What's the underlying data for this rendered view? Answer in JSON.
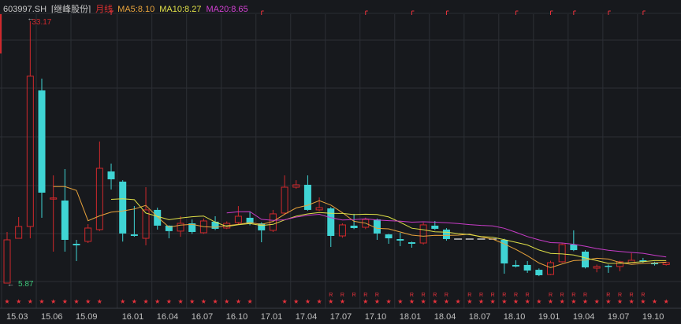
{
  "header": {
    "code": "603997.SH",
    "name": "[继峰股份]",
    "period": "月线",
    "ma5": "MA5:8.10",
    "ma10": "MA10:8.27",
    "ma20": "MA20:8.65"
  },
  "colors": {
    "background": "#17191d",
    "up": "#d0282c",
    "down": "#3fd4d4",
    "ma5": "#e8a33c",
    "ma10": "#e0e048",
    "ma20": "#c83cc8",
    "grid": "#2c2f35",
    "marker": "#e8323c"
  },
  "chart_data": {
    "type": "candlestick",
    "title": "603997.SH [继峰股份] 月线",
    "ylim": [
      5.87,
      33.17
    ],
    "max_label": "33.17",
    "min_label": "5.87",
    "max_index": 2,
    "min_index": 0,
    "xticks": [
      {
        "i": 0,
        "label": "15.03"
      },
      {
        "i": 3,
        "label": "15.06"
      },
      {
        "i": 6,
        "label": "15.09"
      },
      {
        "i": 10,
        "label": "16.01"
      },
      {
        "i": 13,
        "label": "16.04"
      },
      {
        "i": 16,
        "label": "16.07"
      },
      {
        "i": 19,
        "label": "16.10"
      },
      {
        "i": 22,
        "label": "17.01"
      },
      {
        "i": 25,
        "label": "17.04"
      },
      {
        "i": 28,
        "label": "17.07"
      },
      {
        "i": 31,
        "label": "17.10"
      },
      {
        "i": 34,
        "label": "18.01"
      },
      {
        "i": 37,
        "label": "18.04"
      },
      {
        "i": 40,
        "label": "18.07"
      },
      {
        "i": 43,
        "label": "18.10"
      },
      {
        "i": 46,
        "label": "19.01"
      },
      {
        "i": 49,
        "label": "19.04"
      },
      {
        "i": 52,
        "label": "19.07"
      },
      {
        "i": 55,
        "label": "19.10"
      }
    ],
    "ohlc": [
      [
        5.87,
        10.38,
        11.2,
        5.87
      ],
      [
        10.54,
        11.77,
        12.76,
        10.54
      ],
      [
        11.77,
        27.44,
        33.17,
        10.54
      ],
      [
        25.96,
        15.3,
        27.19,
        12.68
      ],
      [
        14.7,
        14.75,
        17.1,
        9.15
      ],
      [
        14.48,
        10.38,
        17.76,
        9.15
      ],
      [
        9.97,
        9.81,
        10.38,
        8.17
      ],
      [
        10.22,
        11.61,
        12.02,
        10.05
      ],
      [
        11.45,
        17.84,
        20.63,
        11.3
      ],
      [
        17.51,
        16.69,
        18.33,
        15.63
      ],
      [
        16.45,
        11.04,
        16.6,
        10.2
      ],
      [
        10.95,
        10.79,
        13.9,
        10.7
      ],
      [
        10.54,
        13.5,
        15.87,
        9.81
      ],
      [
        13.5,
        11.86,
        13.74,
        11.45
      ],
      [
        11.86,
        11.29,
        11.9,
        10.54
      ],
      [
        11.29,
        12.1,
        12.84,
        10.7
      ],
      [
        12.1,
        11.2,
        12.5,
        11.0
      ],
      [
        11.12,
        12.35,
        12.6,
        11.0
      ],
      [
        12.27,
        11.53,
        12.84,
        11.4
      ],
      [
        11.61,
        12.1,
        12.3,
        11.5
      ],
      [
        12.18,
        12.84,
        13.9,
        12.0
      ],
      [
        12.68,
        12.1,
        13.3,
        11.9
      ],
      [
        12.1,
        11.37,
        12.2,
        10.13
      ],
      [
        11.37,
        13.09,
        13.5,
        11.2
      ],
      [
        13.17,
        15.87,
        17.1,
        13.0
      ],
      [
        15.87,
        16.12,
        16.6,
        15.7
      ],
      [
        16.12,
        13.5,
        17.1,
        13.4
      ],
      [
        13.5,
        13.74,
        14.8,
        13.4
      ],
      [
        13.66,
        10.79,
        13.8,
        9.64
      ],
      [
        10.79,
        11.94,
        12.1,
        10.6
      ],
      [
        11.86,
        11.61,
        13.09,
        11.5
      ],
      [
        11.69,
        12.51,
        12.7,
        11.5
      ],
      [
        12.51,
        11.04,
        12.6,
        10.38
      ],
      [
        10.95,
        10.54,
        11.0,
        9.97
      ],
      [
        10.46,
        10.3,
        11.12,
        9.72
      ],
      [
        10.13,
        9.97,
        10.2,
        9.56
      ],
      [
        10.05,
        11.94,
        12.18,
        9.89
      ],
      [
        11.86,
        11.53,
        12.35,
        11.4
      ],
      [
        11.45,
        10.46,
        11.6,
        10.3
      ],
      [
        10.46,
        10.46,
        10.46,
        10.46
      ],
      [
        10.46,
        10.46,
        10.46,
        10.46
      ],
      [
        10.46,
        10.46,
        10.46,
        10.46
      ],
      [
        10.46,
        10.46,
        10.46,
        10.46
      ],
      [
        10.38,
        7.92,
        10.5,
        6.85
      ],
      [
        7.76,
        7.6,
        8.25,
        7.5
      ],
      [
        7.76,
        7.18,
        8.17,
        6.94
      ],
      [
        7.26,
        6.69,
        7.4,
        6.6
      ],
      [
        6.77,
        8.0,
        8.2,
        6.7
      ],
      [
        8.09,
        9.89,
        10.0,
        8.0
      ],
      [
        9.89,
        9.31,
        11.37,
        9.2
      ],
      [
        9.15,
        7.51,
        9.3,
        7.4
      ],
      [
        7.43,
        7.6,
        7.8,
        7.0
      ],
      [
        7.68,
        7.6,
        7.8,
        6.94
      ],
      [
        7.6,
        8.09,
        8.2,
        7.1
      ],
      [
        8.0,
        8.25,
        9.0,
        8.0
      ],
      [
        8.25,
        8.09,
        8.5,
        8.0
      ],
      [
        8.0,
        7.84,
        8.1,
        7.7
      ],
      [
        7.8,
        8.0,
        8.1,
        7.7
      ]
    ],
    "suspended": [
      39,
      40,
      41,
      42
    ],
    "ma_periods": [
      5,
      10,
      20
    ],
    "star_marker": "★",
    "r_marker": "R",
    "star_indices": [
      0,
      1,
      2,
      3,
      4,
      5,
      6,
      7,
      8,
      10,
      11,
      12,
      13,
      14,
      15,
      16,
      17,
      18,
      19,
      20,
      21,
      24,
      25,
      26,
      27,
      28,
      29,
      31,
      32,
      33,
      34,
      35,
      36,
      37,
      38,
      39,
      40,
      41,
      42,
      43,
      44,
      45,
      46,
      47,
      48,
      49,
      50,
      51,
      52,
      53,
      54,
      55,
      56,
      57
    ],
    "r_indices": [
      28,
      29,
      30,
      31,
      32,
      35,
      36,
      37,
      38,
      40,
      41,
      42,
      43,
      44,
      45,
      47,
      48,
      49,
      50,
      52,
      53,
      54,
      55
    ]
  }
}
